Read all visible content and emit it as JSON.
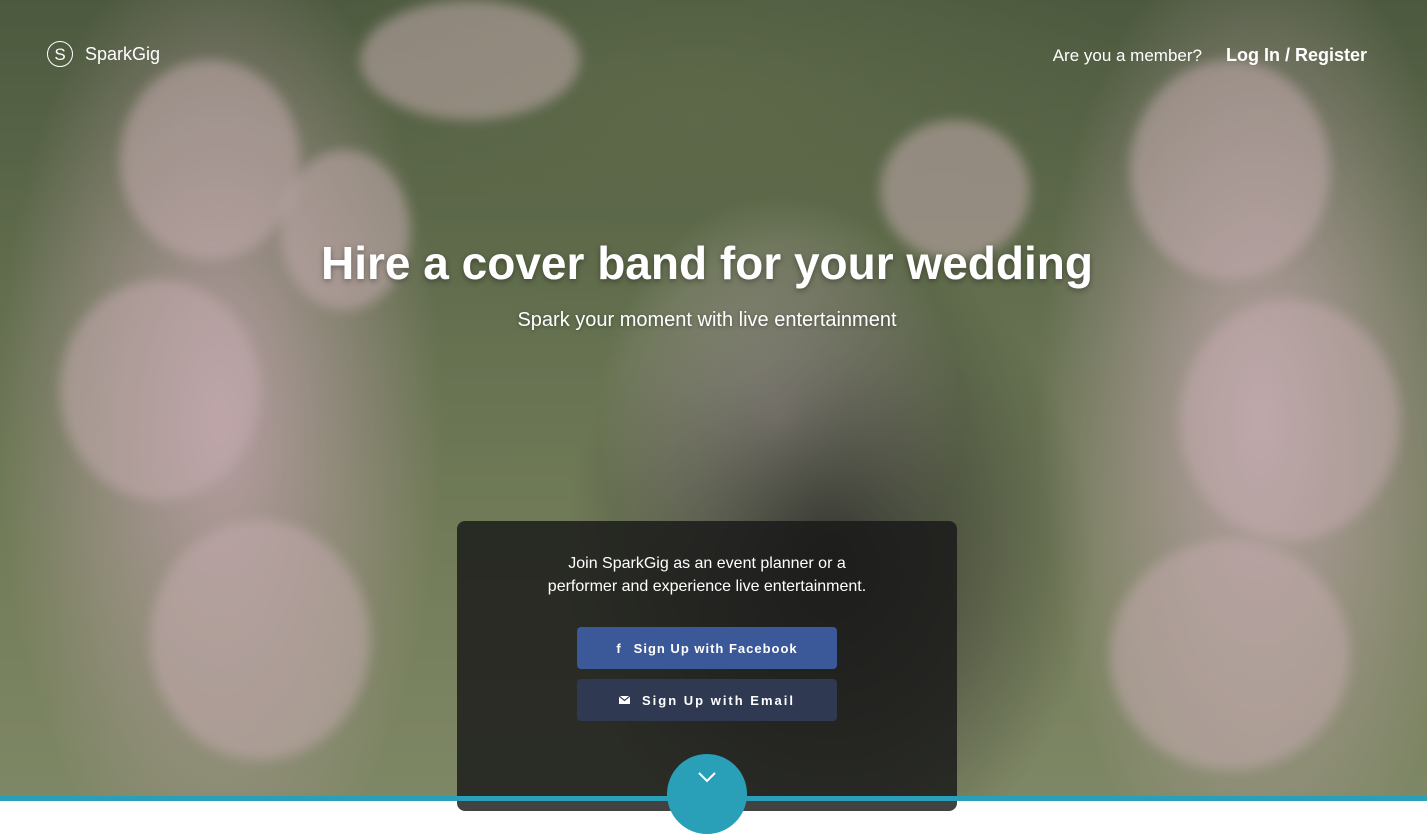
{
  "brand": {
    "name": "SparkGig",
    "logo_letter": "S"
  },
  "nav": {
    "member_prompt": "Are you a member?",
    "login_label": "Log In / Register"
  },
  "hero": {
    "headline": "Hire a cover band for your wedding",
    "subheadline": "Spark your moment with live entertainment"
  },
  "signup": {
    "intro_line1": "Join SparkGig as an event planner or a",
    "intro_line2": "performer and experience live entertainment.",
    "facebook_label": "Sign Up with Facebook",
    "email_label": "Sign Up with Email"
  },
  "icons": {
    "logo": "logo-circle-icon",
    "facebook": "facebook-icon",
    "email": "envelope-icon",
    "scroll": "chevron-down-icon"
  },
  "colors": {
    "facebook_button": "#3b5998",
    "email_button": "#2f3a52",
    "accent": "#2aa0b8"
  }
}
